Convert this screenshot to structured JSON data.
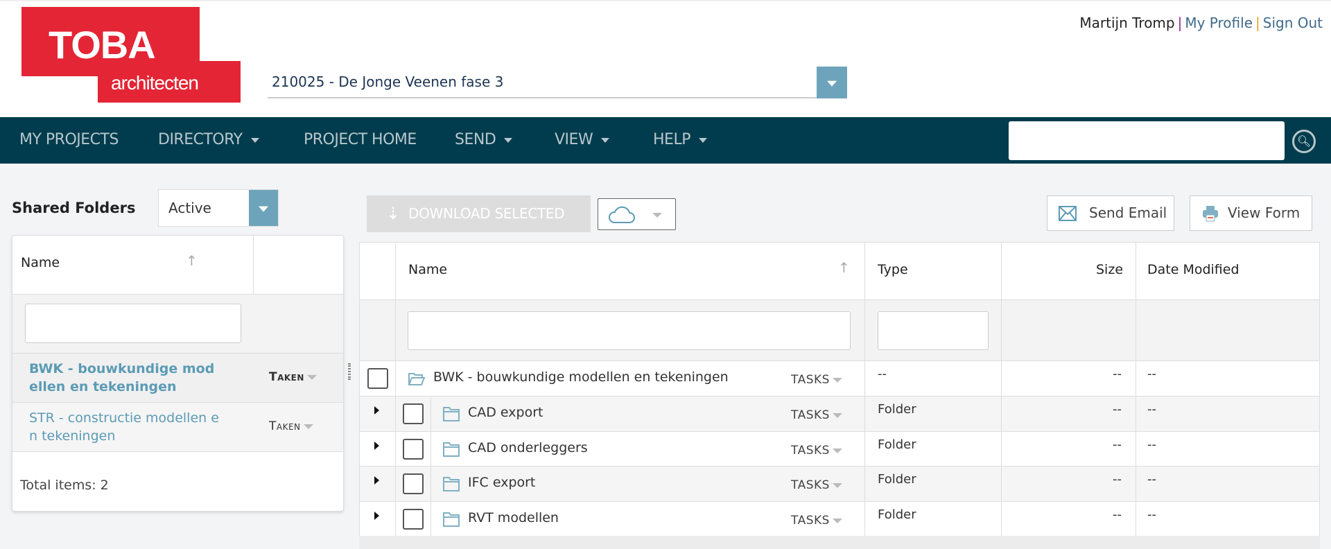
{
  "brand": {
    "logo_line1": "TOBA",
    "logo_line2": "architecten",
    "color": "#e42535"
  },
  "project_select": {
    "value": "210025 - De Jonge Veenen fase 3"
  },
  "user_bar": {
    "name": "Martijn Tromp",
    "separator": "|",
    "profile": "My Profile",
    "sign_out": "Sign Out"
  },
  "nav": {
    "items": [
      {
        "label": "MY PROJECTS",
        "dropdown": false
      },
      {
        "label": "DIRECTORY",
        "dropdown": true
      },
      {
        "label": "PROJECT HOME",
        "dropdown": false
      },
      {
        "label": "SEND",
        "dropdown": true
      },
      {
        "label": "VIEW",
        "dropdown": true
      },
      {
        "label": "HELP",
        "dropdown": true
      }
    ],
    "search_value": "",
    "search_icon": "search-icon",
    "bg": "#003c4d"
  },
  "left_panel": {
    "title": "Shared Folders",
    "status_filter": "Active",
    "column_name": "Name",
    "filter_value": "",
    "rows": [
      {
        "name": "BWK - bouwkundige mod ellen en tekeningen",
        "line1": "BWK - bouwkundige mod",
        "line2": "ellen en tekeningen",
        "action": "Taken",
        "selected": true
      },
      {
        "name": "STR - constructie modellen e n tekeningen",
        "line1": "STR - constructie modellen e",
        "line2": "n tekeningen",
        "action": "Taken",
        "selected": false
      }
    ],
    "total": "Total items: 2"
  },
  "toolbar": {
    "download": "DOWNLOAD SELECTED",
    "download_icon": "download-arrow-icon",
    "cloud_icon": "cloud-icon",
    "send_email": "Send Email",
    "view_form": "View Form"
  },
  "grid": {
    "columns": {
      "name": "Name",
      "type": "Type",
      "size": "Size",
      "date": "Date Modified"
    },
    "filters": {
      "name": "",
      "type": ""
    },
    "rows": [
      {
        "name": "BWK - bouwkundige modellen en tekeningen",
        "tasks": "TASKS",
        "type": "--",
        "size": "--",
        "date": "--",
        "parent": true
      },
      {
        "name": "CAD export",
        "tasks": "TASKS",
        "type": "Folder",
        "size": "--",
        "date": "--"
      },
      {
        "name": "CAD onderleggers",
        "tasks": "TASKS",
        "type": "Folder",
        "size": "--",
        "date": "--"
      },
      {
        "name": "IFC export",
        "tasks": "TASKS",
        "type": "Folder",
        "size": "--",
        "date": "--"
      },
      {
        "name": "RVT modellen",
        "tasks": "TASKS",
        "type": "Folder",
        "size": "--",
        "date": "--"
      }
    ]
  }
}
